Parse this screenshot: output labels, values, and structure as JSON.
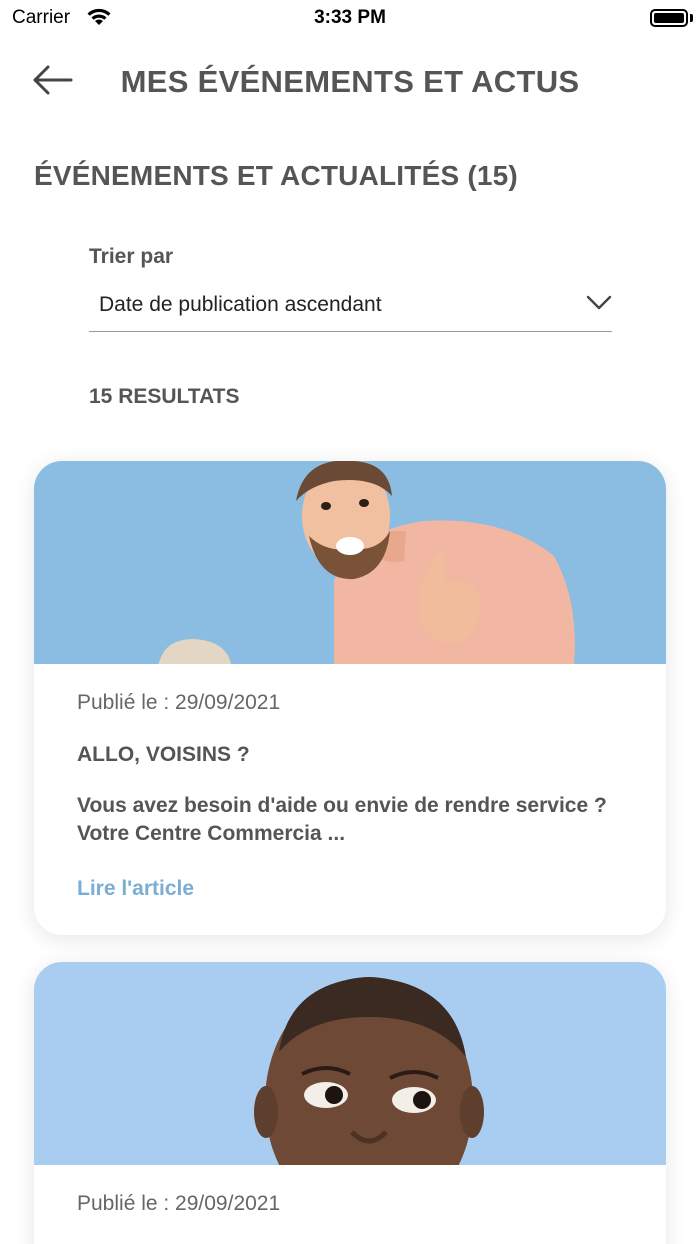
{
  "status_bar": {
    "carrier": "Carrier",
    "time": "3:33 PM",
    "icons": [
      "wifi-icon",
      "battery-icon"
    ]
  },
  "header": {
    "title": "MES ÉVÉNEMENTS ET ACTUS",
    "back_icon": "arrow-left-icon"
  },
  "section": {
    "title": "ÉVÉNEMENTS ET ACTUALITÉS (15)"
  },
  "sort": {
    "label": "Trier par",
    "selected": "Date de publication ascendant",
    "icon": "chevron-down-icon"
  },
  "results": {
    "count_label": "15 RESULTATS"
  },
  "cards": [
    {
      "date": "Publié le : 29/09/2021",
      "title": "ALLO, VOISINS ?",
      "excerpt_line1": "Vous avez besoin d'aide ou envie de rendre service ?",
      "excerpt_line2": "Votre Centre Commercia ...",
      "link": "Lire l'article",
      "image_bg": "#8bbde3"
    },
    {
      "date": "Publié le : 29/09/2021",
      "image_bg": "#a9cdf1"
    }
  ],
  "colors": {
    "text": "#555555",
    "link": "#7aaed3",
    "divider": "#9a9a9a"
  }
}
